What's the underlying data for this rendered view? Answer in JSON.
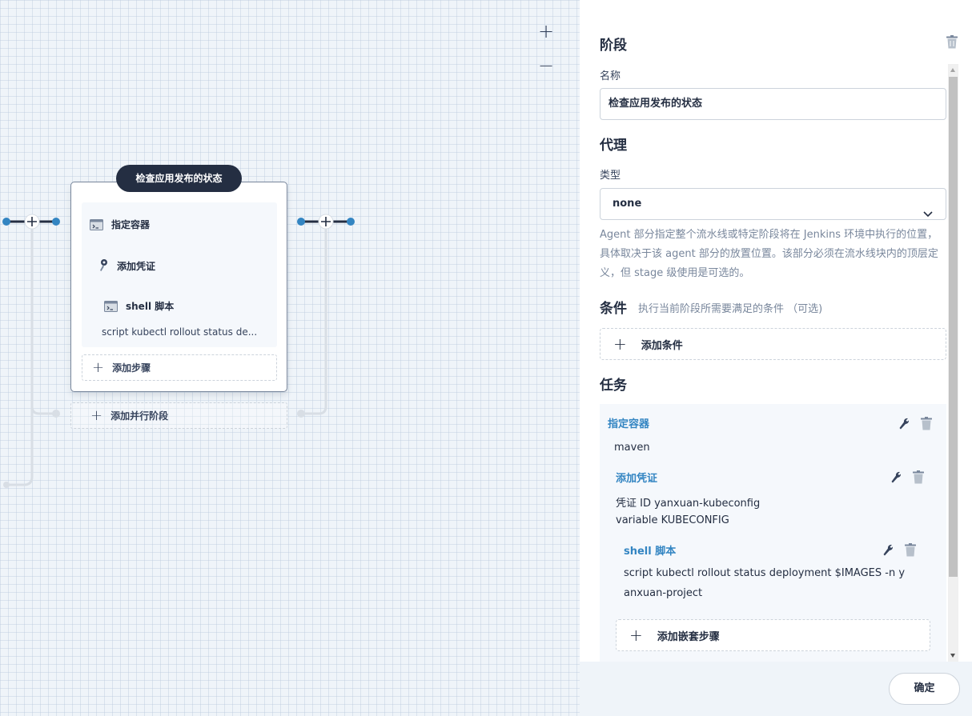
{
  "canvas": {
    "zoom_in": "+",
    "zoom_out": "−",
    "stage": {
      "title": "检查应用发布的状态",
      "steps": [
        {
          "label": "指定容器",
          "icon": "terminal-icon"
        },
        {
          "label": "添加凭证",
          "icon": "key-icon"
        },
        {
          "label": "shell 脚本",
          "icon": "terminal-icon"
        }
      ],
      "script_preview": "script   kubectl rollout status de...",
      "add_step": "添加步骤"
    },
    "add_parallel": "添加并行阶段",
    "colors": {
      "node": "#3385c2",
      "line": "#242e42",
      "branch": "#d8dee5"
    }
  },
  "panel": {
    "stage_section": "阶段",
    "name_label": "名称",
    "name_value": "检查应用发布的状态",
    "agent_section": "代理",
    "type_label": "类型",
    "type_value": "none",
    "agent_description": "Agent 部分指定整个流水线或特定阶段将在 Jenkins 环境中执行的位置， 具体取决于该 agent 部分的放置位置。该部分必须在流水线块内的顶层定义，但 stage 级使用是可选的。",
    "condition_section": "条件",
    "condition_hint": "执行当前阶段所需要满足的条件 （可选)",
    "add_condition": "添加条件",
    "tasks_section": "任务",
    "tasks": {
      "container": {
        "title": "指定容器",
        "value": "maven"
      },
      "credential": {
        "title": "添加凭证",
        "id_line": "凭证 ID   yanxuan-kubeconfig",
        "variable_line": "variable   KUBECONFIG"
      },
      "shell": {
        "title": "shell 脚本",
        "script_line1": "script   kubectl rollout status deployment $IMAGES -n y",
        "script_line2": "anxuan-project"
      },
      "add_nested": "添加嵌套步骤"
    },
    "ok_button": "确定",
    "accent_color": "#3385c2"
  }
}
